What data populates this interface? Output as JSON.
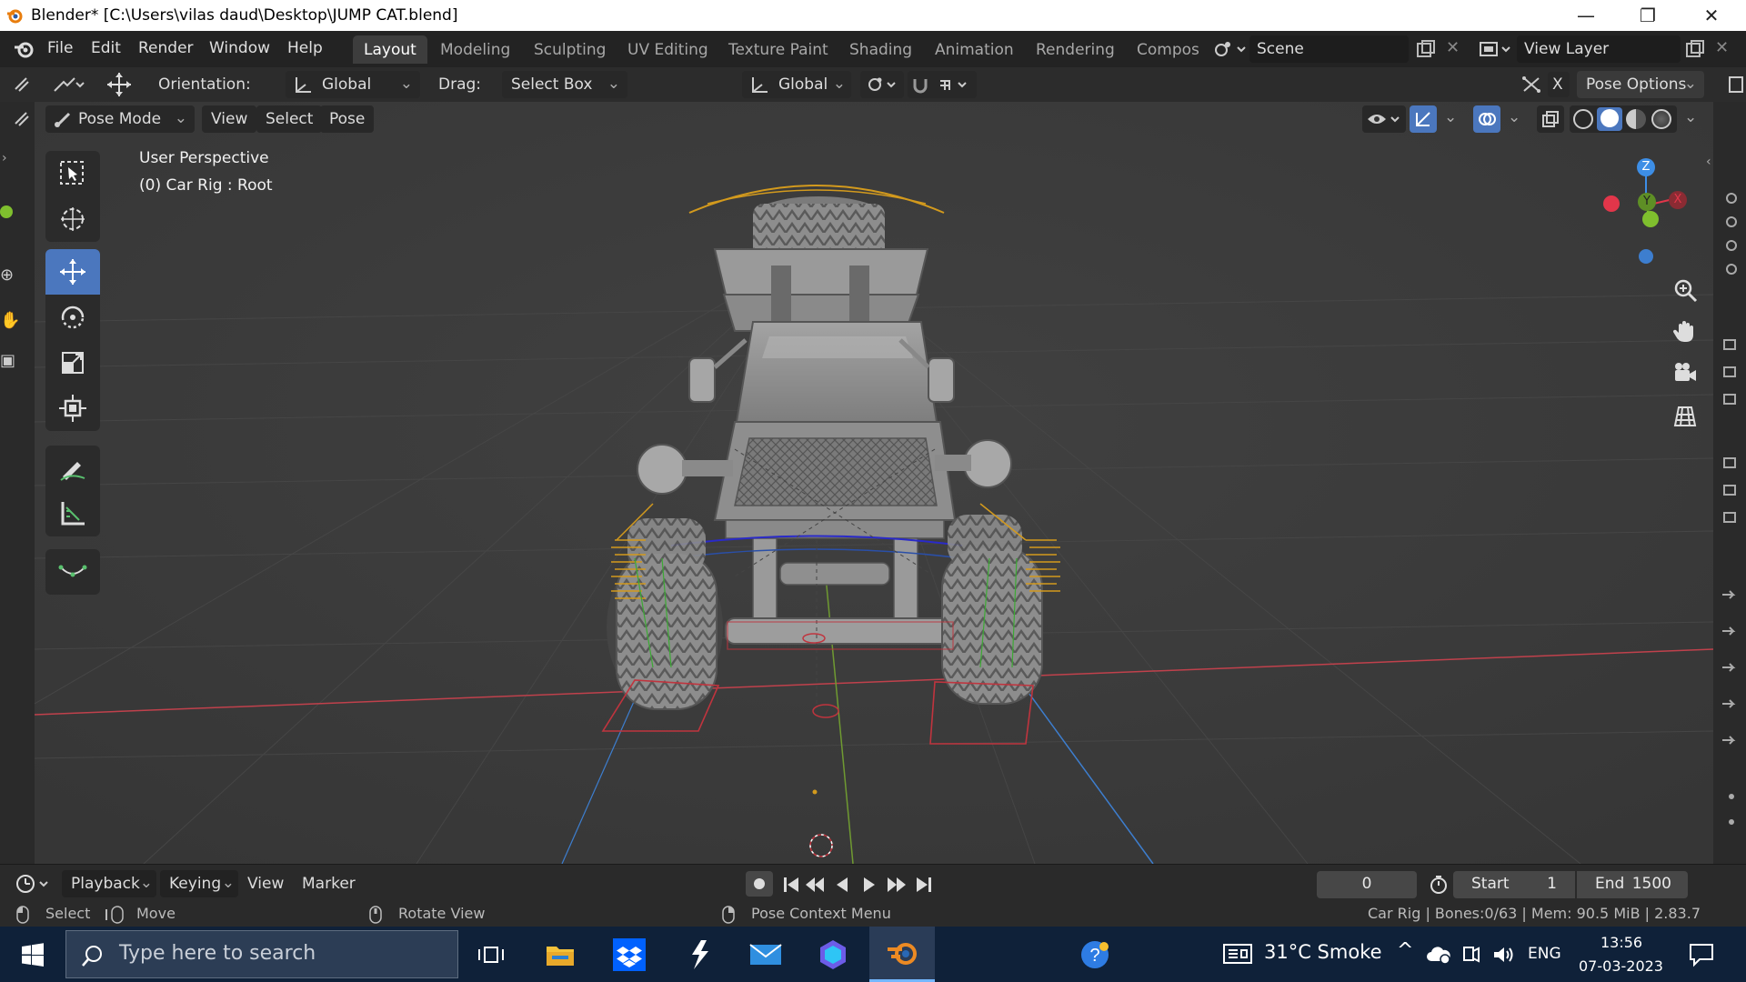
{
  "window": {
    "title": "Blender* [C:\\Users\\vilas daud\\Desktop\\JUMP CAT.blend]"
  },
  "menu": {
    "items": [
      "File",
      "Edit",
      "Render",
      "Window",
      "Help"
    ]
  },
  "workspaces": {
    "tabs": [
      "Layout",
      "Modeling",
      "Sculpting",
      "UV Editing",
      "Texture Paint",
      "Shading",
      "Animation",
      "Rendering",
      "Compos"
    ],
    "active": "Layout"
  },
  "scene": {
    "name": "Scene",
    "view_layer": "View Layer"
  },
  "tool_header": {
    "orientation_label": "Orientation:",
    "orientation_value": "Global",
    "drag_label": "Drag:",
    "drag_value": "Select Box",
    "transform_orientation": "Global",
    "options_label": "Pose Options",
    "close_x": "X"
  },
  "view_header": {
    "mode": "Pose Mode",
    "menus": [
      "View",
      "Select",
      "Pose"
    ]
  },
  "viewport": {
    "perspective": "User Perspective",
    "active_object": "(0) Car Rig : Root",
    "gizmo_axes": {
      "z": "Z",
      "y": "Y",
      "x": "X"
    }
  },
  "timeline": {
    "menus": [
      "Playback",
      "Keying",
      "View",
      "Marker"
    ],
    "current_frame": "0",
    "start_label": "Start",
    "start_value": "1",
    "end_label": "End",
    "end_value": "1500"
  },
  "statusbar": {
    "select": "Select",
    "move": "Move",
    "rotate": "Rotate View",
    "context": "Pose Context Menu",
    "info": "Car Rig | Bones:0/63 | Mem: 90.5 MiB | 2.83.7"
  },
  "taskbar": {
    "search_placeholder": "Type here to search",
    "weather": "31°C  Smoke",
    "language": "ENG",
    "time": "13:56",
    "date": "07-03-2023"
  },
  "colors": {
    "accent": "#4b77be",
    "viewport_bg": "#3c3c3c",
    "axis_x": "#e2364a",
    "axis_y": "#7fbf2e",
    "axis_z": "#3d8ee6"
  }
}
